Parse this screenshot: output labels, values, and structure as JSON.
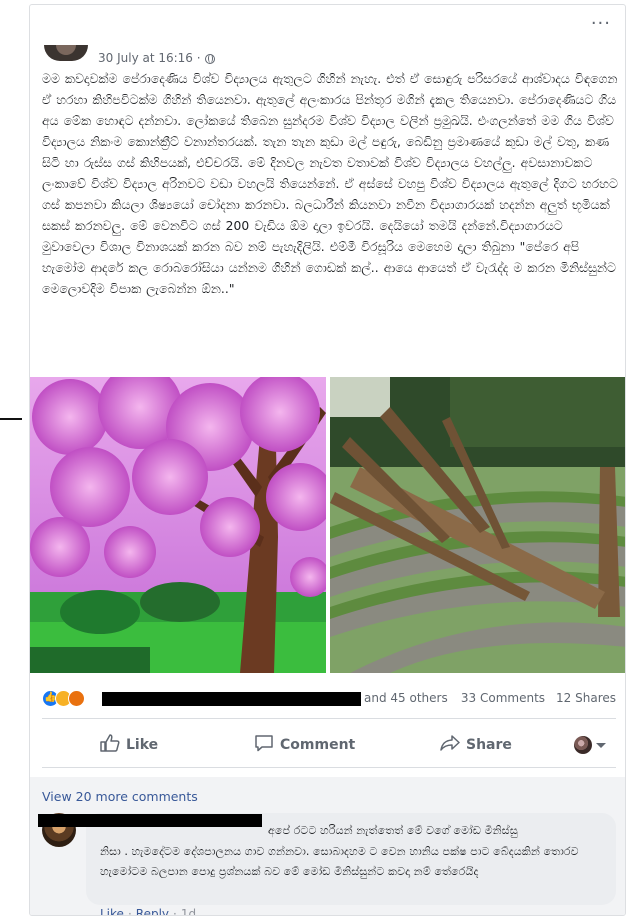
{
  "post": {
    "timestamp": "30 July at 16:16 ·",
    "more_menu_glyph": "···",
    "body": "මම කවදාවක්ම පේරාදෙණිය විශ්ව විද්‍යාලය ඇතුලට ගිහින් නැහැ. එත් ඒ සොඳුරු පරිසරයේ ආශ්වාදය විඳගෙන ඒ හරහා කිහිපවිටක්ම ගිහින් තියෙනවා. ඇතුලේ අලංකාරය පින්තූර මගින් දැකල තියෙනවා. පේරාදෙණියට ගිය අය මේක හොඳට දන්නවා. ලෝකයේ තිබෙන සුන්දරම විශ්ව විද්‍යාල වලින් ප්‍රමුඛයි. එංගලන්තේ මම ගිය විශ්ව විද්‍යාලය නිකංම කොන්ක්‍රීට් වනාන්තරයක්. තැන තැන කුඩා මල් පඳුරු, බෙඩිනු ප්‍රමාණයේ කුඩා මල් වතු, කණ සිටි හා රුස්ස ගස් කිහිපයක්, එච්චරයි. මේ දිනවල නැවත වතාවක් විශ්ව විද්‍යාලය වහල්ලු. අවසානාවකට ලංකාවේ විශ්ව විද්‍යාල අරිනවට වඩා වහලයි තියෙන්නේ. ඒ අස්සේ වහපු විශ්ව විද්‍යාලය ඇතුලේ දිගට හරහට ගස් කපනවා කියලා ශිෂ්‍යයෝ චෝදනා කරනවා. බලධාරීන් කියනවා නවීන විද්‍යාගාරයක් හදන්න අලුත් භූමියක් සකස් කරනවලු. මේ වෙනවිට ගස් 200 වැඩිය ඕම දාලා ඉවරයි. දෙයියෝ තමයි දන්නේ.විද්‍යාගාරයට මුවාවෙලා විශාල විනාශයක් කරන බව නම් පැහැදිලියි. එම්මී විරසූරිය මෙහෙම දාලා තිබුනා \"පේරෙ අපි හැමෝම ආදරේ කල රොබරෝසියා යන්නම ගිහින් ගොඩක් කල්.. ආයෙ ආයෙත් ඒ වැරැද්ද ම කරන මිනිස්සුන්ට මෙලොවදිම විපාක ලැබෙන්න ඕන..\""
  },
  "photos": {
    "left_icon": "tree-blossom-photo",
    "right_icon": "felled-tree-photo"
  },
  "reactions": {
    "others_text": "and 45 others",
    "comments_count": "33 Comments",
    "shares_count": "12 Shares",
    "emoji": [
      "like-reaction-icon",
      "sad-reaction-icon",
      "angry-reaction-icon"
    ],
    "like_glyph": "👍",
    "colors": {
      "like": "#1877f2",
      "sad": "#f7b125",
      "angry": "#e9710f"
    }
  },
  "actions": {
    "like_label": "Like",
    "comment_label": "Comment",
    "share_label": "Share"
  },
  "comments": {
    "view_more": "View 20 more comments",
    "first": {
      "lead": "අපේ රටට හරියන් නැත්තෙත් මේ වගේ මෝඩ මිනිස්සු",
      "rest": "නිසා . හැමදේටම දේශපාලනය ගාව ගන්නවා. සොබාදහම ට වෙන හානිය පක්ෂ පාට බේදයකින් තොරව හැමෝටම බලපාන පොදු ප්‍රශ්නයක් බව මේ මෝඩ මිනිස්සුන්ට කවදා නම් තේරෙයිද",
      "like_label": "Like",
      "reply_label": "Reply",
      "age": "1d"
    }
  },
  "theme": {
    "link": "#385898",
    "muted": "#606770",
    "comment_bg": "#f2f3f5",
    "bubble_bg": "#ebedf0"
  }
}
